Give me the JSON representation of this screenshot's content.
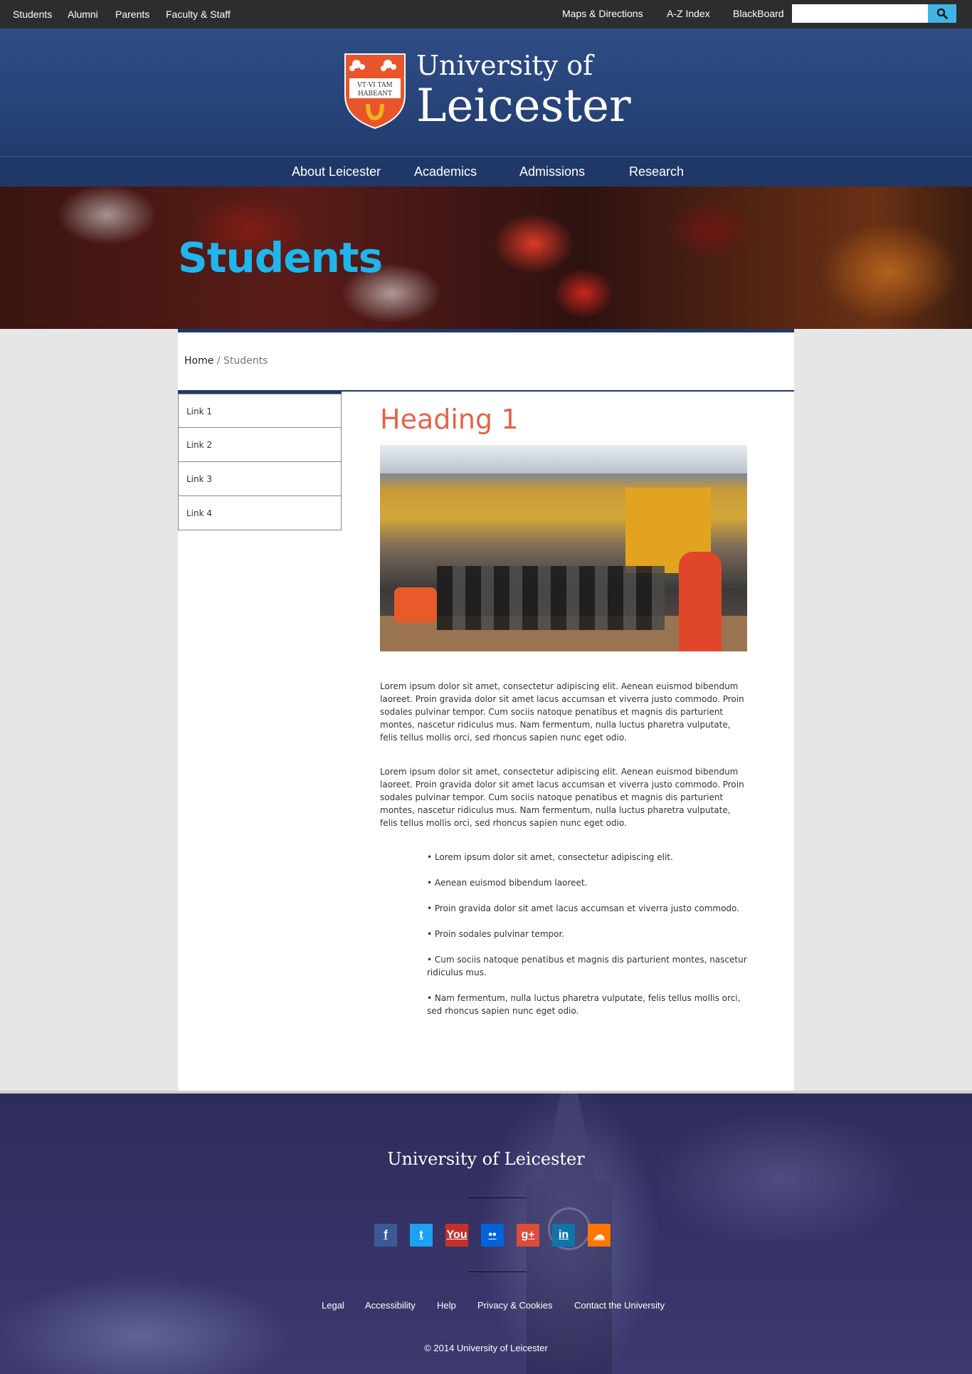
{
  "utility_nav": {
    "left": [
      "Students",
      "Alumni",
      "Parents",
      "Faculty & Staff"
    ],
    "right": [
      "Maps & Directions",
      "A-Z Index",
      "BlackBoard"
    ],
    "search_placeholder": ""
  },
  "logo": {
    "line1": "University of",
    "line2": "Leicester",
    "motto_line1": "VT·VI TAM",
    "motto_line2": "HABEANT"
  },
  "main_nav": [
    "About Leicester",
    "Academics",
    "Admissions",
    "Research"
  ],
  "hero": {
    "title": "Students"
  },
  "breadcrumb": {
    "home": "Home",
    "separator": " / ",
    "current": "Students"
  },
  "sidenav": [
    "Link 1",
    "Link 2",
    "Link 3",
    "Link 4"
  ],
  "article": {
    "heading": "Heading 1",
    "paragraphs": [
      "Lorem ipsum dolor sit amet, consectetur adipiscing elit. Aenean euismod bibendum laoreet. Proin gravida dolor sit amet lacus accumsan et viverra justo commodo. Proin sodales pulvinar tempor. Cum sociis natoque penatibus et magnis dis parturient montes, nascetur ridiculus mus. Nam fermentum, nulla luctus pharetra vulputate, felis tellus mollis orci, sed rhoncus sapien nunc eget odio.",
      "Lorem ipsum dolor sit amet, consectetur adipiscing elit. Aenean euismod bibendum laoreet. Proin gravida dolor sit amet lacus accumsan et viverra justo commodo. Proin sodales pulvinar tempor. Cum sociis natoque penatibus et magnis dis parturient montes, nascetur ridiculus mus. Nam fermentum, nulla luctus pharetra vulputate, felis tellus mollis orci, sed rhoncus sapien nunc eget odio."
    ],
    "bullets": [
      "• Lorem ipsum dolor sit amet, consectetur adipiscing elit.",
      "• Aenean euismod bibendum laoreet.",
      "• Proin gravida dolor sit amet lacus accumsan et viverra justo commodo.",
      "• Proin sodales pulvinar tempor.",
      "• Cum sociis natoque penatibus et magnis dis parturient montes, nascetur ridiculus mus.",
      "• Nam fermentum, nulla luctus pharetra vulputate, felis tellus mollis orci, sed rhoncus sapien nunc eget odio."
    ]
  },
  "footer": {
    "logo": "University of Leicester",
    "social": [
      {
        "name": "facebook-icon",
        "glyph": "f",
        "color": "#3b5998"
      },
      {
        "name": "twitter-icon",
        "glyph": "t",
        "color": "#1da1f2"
      },
      {
        "name": "youtube-icon",
        "glyph": "You",
        "color": "#c4302b"
      },
      {
        "name": "flickr-icon",
        "glyph": "••",
        "color": "#0063dc"
      },
      {
        "name": "google-plus-icon",
        "glyph": "g+",
        "color": "#dd4b39"
      },
      {
        "name": "linkedin-icon",
        "glyph": "in",
        "color": "#0e76a8"
      },
      {
        "name": "soundcloud-icon",
        "glyph": "☁",
        "color": "#ff7700"
      }
    ],
    "links": [
      "Legal",
      "Accessibility",
      "Help",
      "Privacy & Cookies",
      "Contact the University"
    ],
    "copyright": "© 2014 University of Leicester"
  },
  "colors": {
    "navy": "#1f3867",
    "hero_title": "#1eb6ec",
    "heading": "#e0654a",
    "search_button": "#3fb5e5"
  }
}
